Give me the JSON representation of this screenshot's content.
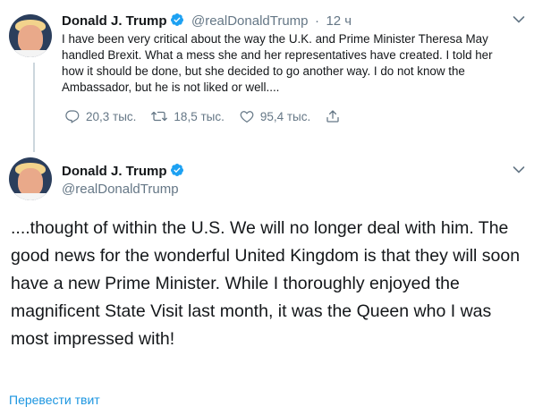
{
  "tweet1": {
    "author_name": "Donald J. Trump",
    "author_handle": "@realDonaldTrump",
    "separator": "·",
    "time": "12 ч",
    "text": "I have been very critical about the way the U.K. and Prime Minister Theresa May handled Brexit. What a mess she and her representatives have created. I told her how it should be done, but she decided to go another way. I do not know the Ambassador, but he is not liked or well....",
    "replies": "20,3 тыс.",
    "retweets": "18,5 тыс.",
    "likes": "95,4 тыс."
  },
  "tweet2": {
    "author_name": "Donald J. Trump",
    "author_handle": "@realDonaldTrump",
    "text": "....thought of within the U.S. We will no longer deal with him. The good news for the wonderful United Kingdom is that they will soon have a new Prime Minister. While I thoroughly enjoyed the magnificent State Visit last month, it was the Queen who I was most impressed with!",
    "translate_link": "Перевести твит"
  },
  "colors": {
    "text": "#14171a",
    "muted": "#657786",
    "link": "#1b95e0",
    "verified": "#1da1f2",
    "thread_line": "#ccd6dd"
  },
  "icons": [
    "verified-badge-icon",
    "chevron-down-icon",
    "reply-icon",
    "retweet-icon",
    "like-icon",
    "share-icon"
  ]
}
